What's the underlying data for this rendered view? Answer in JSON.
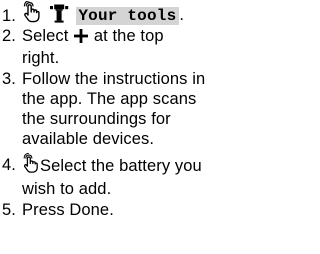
{
  "steps": [
    {
      "number": "1.",
      "icons": [
        "tap-gesture-icon",
        "toolbox-icon"
      ],
      "highlight": "Your tools",
      "trailing": "."
    },
    {
      "number": "2.",
      "prefix": "Select ",
      "icon": "plus-icon",
      "line1_suffix": " at the top",
      "line2": "right."
    },
    {
      "number": "3.",
      "lines": [
        "Follow the instructions in",
        "the app. The app scans",
        "the surroundings for",
        "available devices."
      ]
    },
    {
      "number": "4.",
      "icon": "tap-gesture-icon",
      "line1": "Select the battery you",
      "line2": "wish to add."
    },
    {
      "number": "5.",
      "text": "Press Done."
    }
  ]
}
